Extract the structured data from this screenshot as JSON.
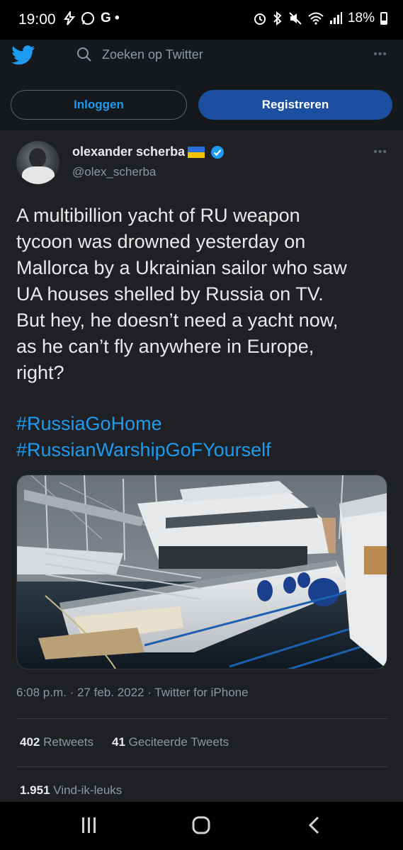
{
  "status_bar": {
    "time": "19:00",
    "left_icons": [
      "lightning-icon",
      "whatsapp-icon",
      "google-icon",
      "dot-icon"
    ],
    "left_glyphs": "G •",
    "battery": "18%"
  },
  "header": {
    "search_placeholder": "Zoeken op Twitter",
    "login_label": "Inloggen",
    "register_label": "Registreren"
  },
  "tweet": {
    "display_name": "olexander scherba",
    "handle": "@olex_scherba",
    "text_lines": [
      "A multibillion yacht of RU weapon",
      "tycoon was drowned yesterday on",
      "Mallorca by a Ukrainian sailor who saw",
      "UA houses shelled by Russia on TV.",
      "But hey, he doesn’t need a yacht now,",
      "as he can’t fly anywhere in Europe,",
      "right?"
    ],
    "hashtags": [
      "#RussiaGoHome",
      "#RussianWarshipGoFYourself"
    ],
    "timestamp": "6:08 p.m. · 27 feb. 2022 · Twitter for iPhone",
    "retweets_count": "402",
    "retweets_label": "Retweets",
    "quotes_count": "41",
    "quotes_label": "Geciteerde Tweets",
    "likes_count": "1.951",
    "likes_label": "Vind-ik-leuks"
  },
  "colors": {
    "accent": "#1d9bf0",
    "register_bg": "#1d4fa0",
    "background": "#1f2023"
  }
}
